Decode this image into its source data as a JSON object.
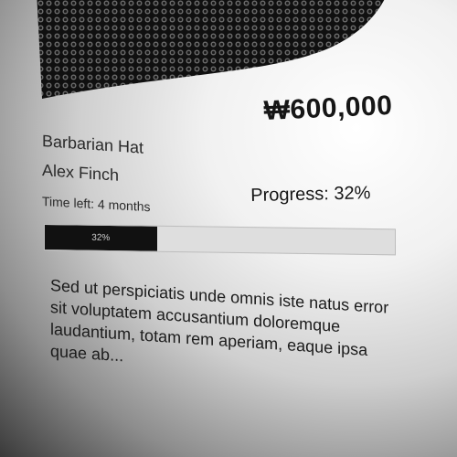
{
  "product": {
    "title": "Barbarian Hat",
    "author": "Alex Finch",
    "price": "₩600,000",
    "time_left": "Time left: 4 months",
    "image_icon": "hat-image"
  },
  "progress": {
    "label": "Progress: 32%",
    "percent": 32,
    "bar_label": "32%",
    "fill_color": "#111111",
    "track_color": "#dedede"
  },
  "description": {
    "text": "Sed ut perspiciatis unde omnis iste natus error sit voluptatem accusantium doloremque laudantium, totam rem aperiam, eaque ipsa quae ab..."
  }
}
